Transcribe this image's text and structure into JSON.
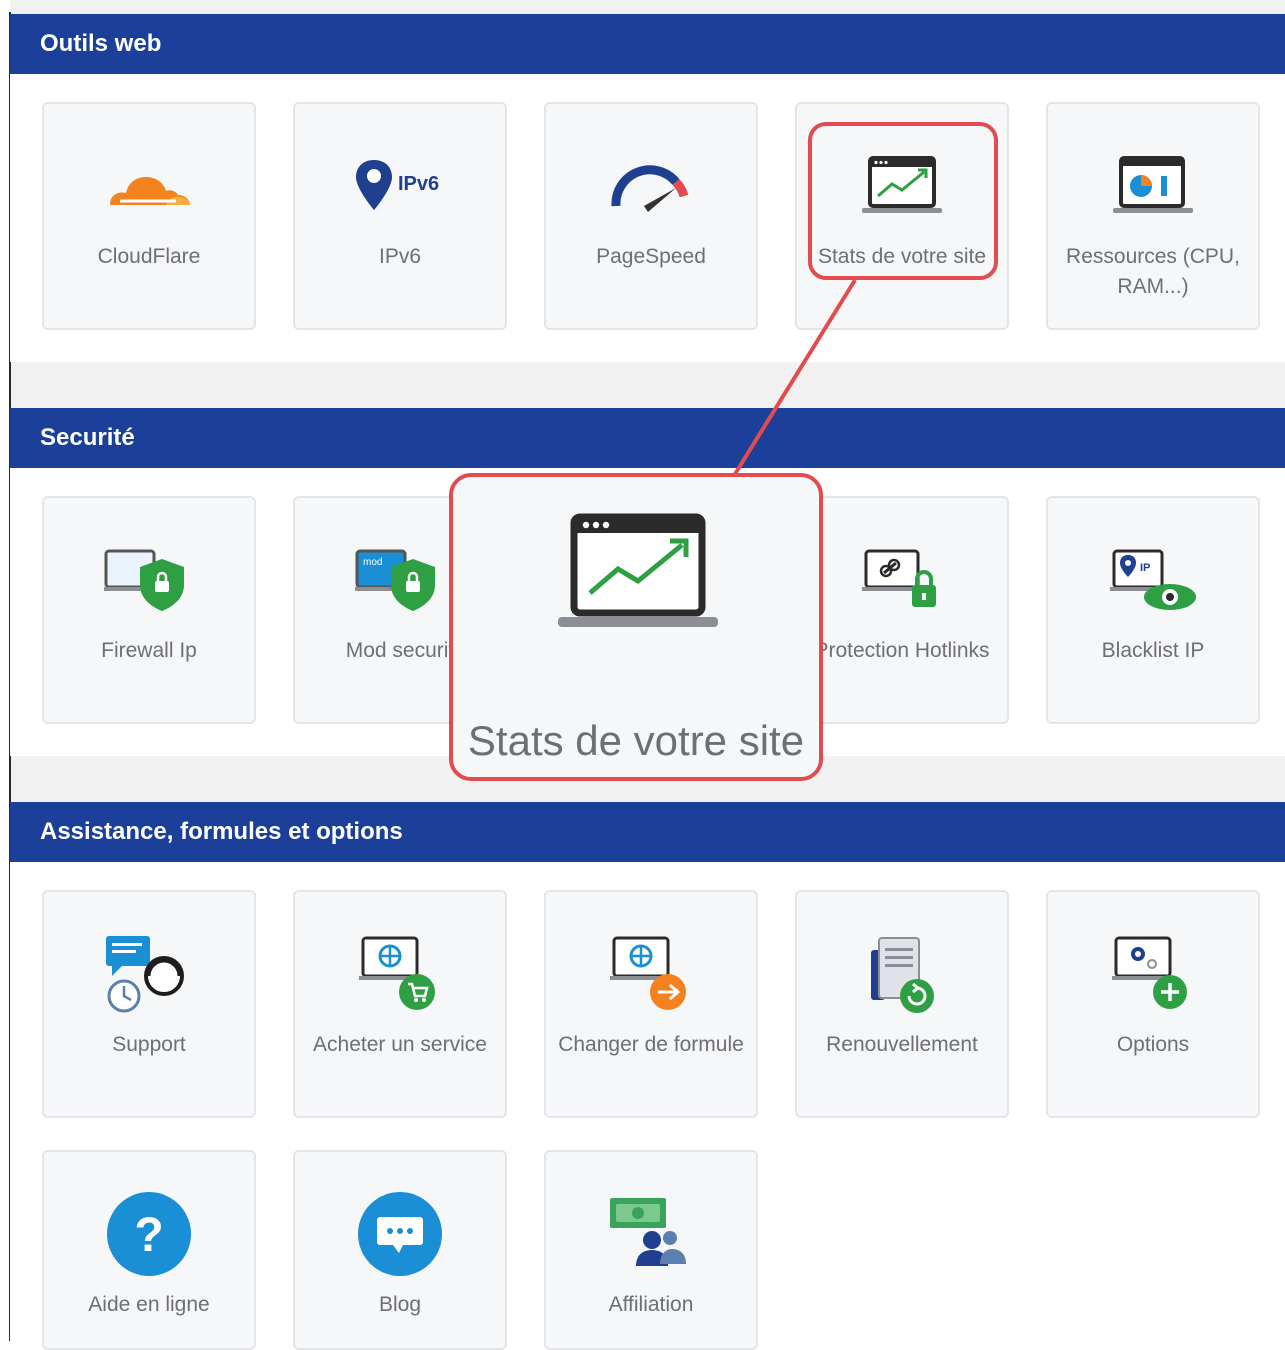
{
  "sections": [
    {
      "title": "Outils web"
    },
    {
      "title": "Securité"
    },
    {
      "title": "Assistance, formules et options"
    }
  ],
  "outils_web": [
    {
      "label": "CloudFlare",
      "icon": "cloudflare-icon"
    },
    {
      "label": "IPv6",
      "icon": "ipv6-icon",
      "badge": "IPv6"
    },
    {
      "label": "PageSpeed",
      "icon": "speedometer-icon"
    },
    {
      "label": "Stats de votre site",
      "icon": "stats-chart-icon"
    },
    {
      "label": "Ressources (CPU, RAM...)",
      "icon": "resources-icon"
    }
  ],
  "securite": [
    {
      "label": "Firewall Ip",
      "icon": "firewall-shield-icon"
    },
    {
      "label": "Mod securit",
      "icon": "mod-security-icon",
      "badge": "mod"
    },
    {
      "label": "Protection Hotlinks",
      "icon": "hotlink-lock-icon"
    },
    {
      "label": "Blacklist IP",
      "icon": "blacklist-eye-icon",
      "badge": "IP"
    }
  ],
  "assistance": [
    {
      "label": "Support",
      "icon": "support-headset-icon"
    },
    {
      "label": "Acheter un service",
      "icon": "buy-service-icon"
    },
    {
      "label": "Changer de formule",
      "icon": "change-plan-icon"
    },
    {
      "label": "Renouvellement",
      "icon": "renewal-icon"
    },
    {
      "label": "Options",
      "icon": "options-gear-icon"
    },
    {
      "label": "Aide en ligne",
      "icon": "help-question-icon"
    },
    {
      "label": "Blog",
      "icon": "blog-chat-icon"
    },
    {
      "label": "Affiliation",
      "icon": "affiliation-icon"
    }
  ],
  "zoom": {
    "label": "Stats de votre site"
  },
  "colors": {
    "header": "#1c3f9a",
    "highlight": "#e24b50",
    "accent_green": "#2ea043",
    "accent_blue": "#1a8fd6"
  }
}
